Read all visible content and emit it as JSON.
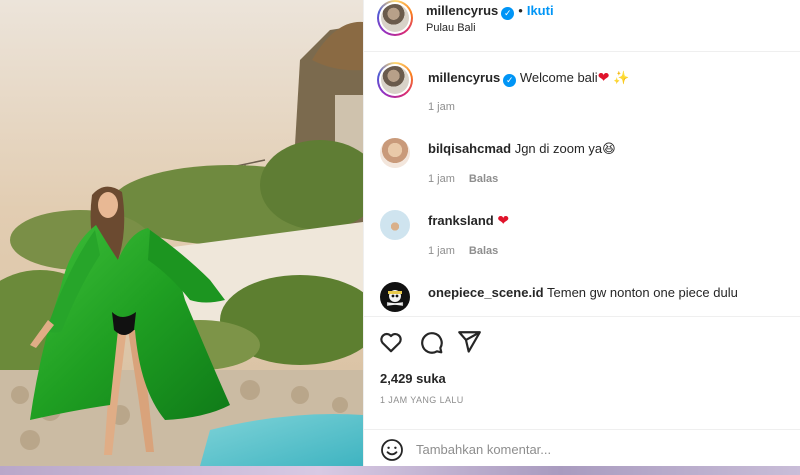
{
  "post": {
    "author": "millencyrus",
    "follow_label": "Ikuti",
    "separator": "•",
    "location": "Pulau Bali",
    "verified_glyph": "✓"
  },
  "caption": {
    "username": "millencyrus",
    "text": "Welcome bali",
    "emojis": [
      "red-heart",
      "sparkles"
    ],
    "heart": "❤",
    "sparkles": "✨",
    "time": "1 jam"
  },
  "comments": [
    {
      "username": "bilqisahcmad",
      "text": "Jgn di zoom ya",
      "emoji": "😆",
      "time": "1 jam",
      "reply_label": "Balas"
    },
    {
      "username": "franksland",
      "text": "",
      "emoji": "❤",
      "time": "1 jam",
      "reply_label": "Balas"
    },
    {
      "username": "onepiece_scene.id",
      "text": "Temen gw nonton one piece dulu"
    }
  ],
  "actions": {
    "icons": [
      "heart-icon",
      "comment-icon",
      "share-icon"
    ]
  },
  "likes": "2,429 suka",
  "time_ago": "1 JAM YANG LALU",
  "add_comment": {
    "placeholder": "Tambahkan komentar..."
  },
  "colors": {
    "accent": "#0095f6",
    "heart": "#e0132b",
    "muted": "#8e8e8e",
    "text": "#262626"
  }
}
